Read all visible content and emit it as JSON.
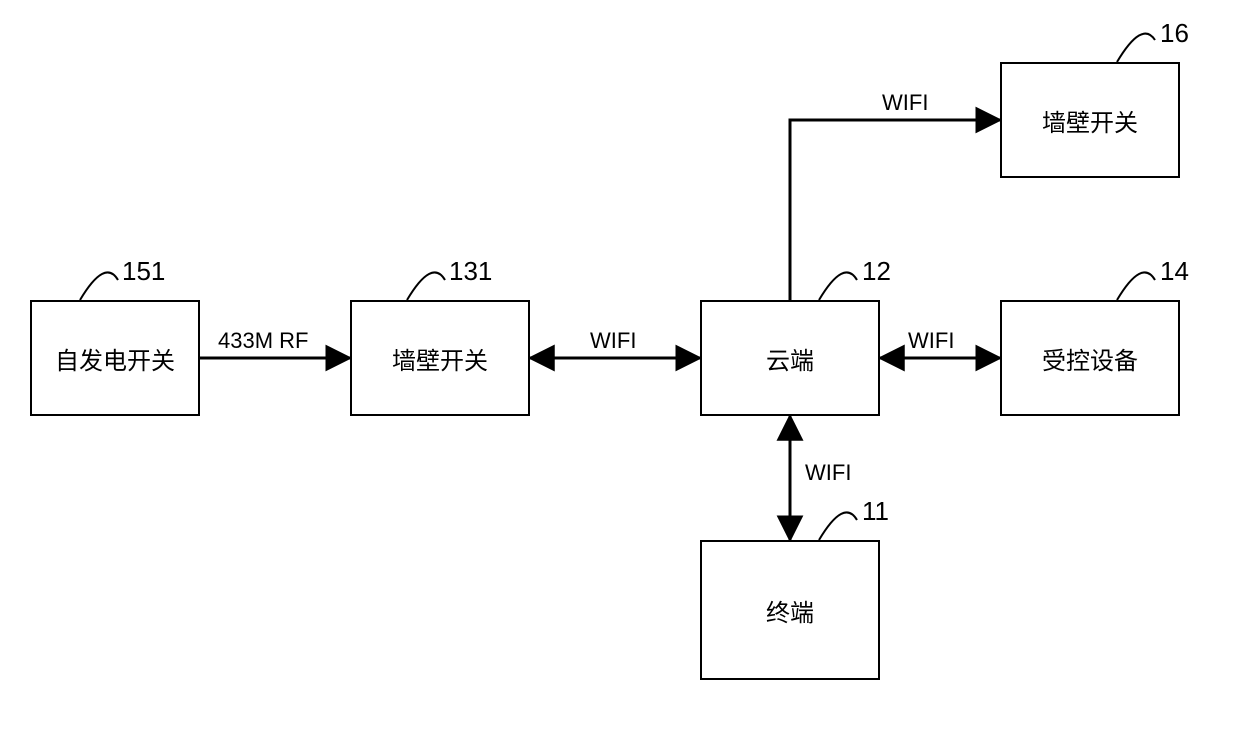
{
  "diagram": {
    "type": "block-diagram",
    "nodes": {
      "n151": {
        "ref": "151",
        "label": "自发电开关"
      },
      "n131": {
        "ref": "131",
        "label": "墙壁开关"
      },
      "n12": {
        "ref": "12",
        "label": "云端"
      },
      "n14": {
        "ref": "14",
        "label": "受控设备"
      },
      "n16": {
        "ref": "16",
        "label": "墙壁开关"
      },
      "n11": {
        "ref": "11",
        "label": "终端"
      }
    },
    "edges": {
      "e_151_131": {
        "from": "n151",
        "to": "n131",
        "direction": "uni",
        "label": "433M RF"
      },
      "e_131_12": {
        "from": "n131",
        "to": "n12",
        "direction": "bi",
        "label": "WIFI"
      },
      "e_12_14": {
        "from": "n12",
        "to": "n14",
        "direction": "bi",
        "label": "WIFI"
      },
      "e_12_16": {
        "from": "n12",
        "to": "n16",
        "direction": "uni",
        "label": "WIFI"
      },
      "e_12_11": {
        "from": "n12",
        "to": "n11",
        "direction": "bi",
        "label": "WIFI"
      }
    }
  }
}
